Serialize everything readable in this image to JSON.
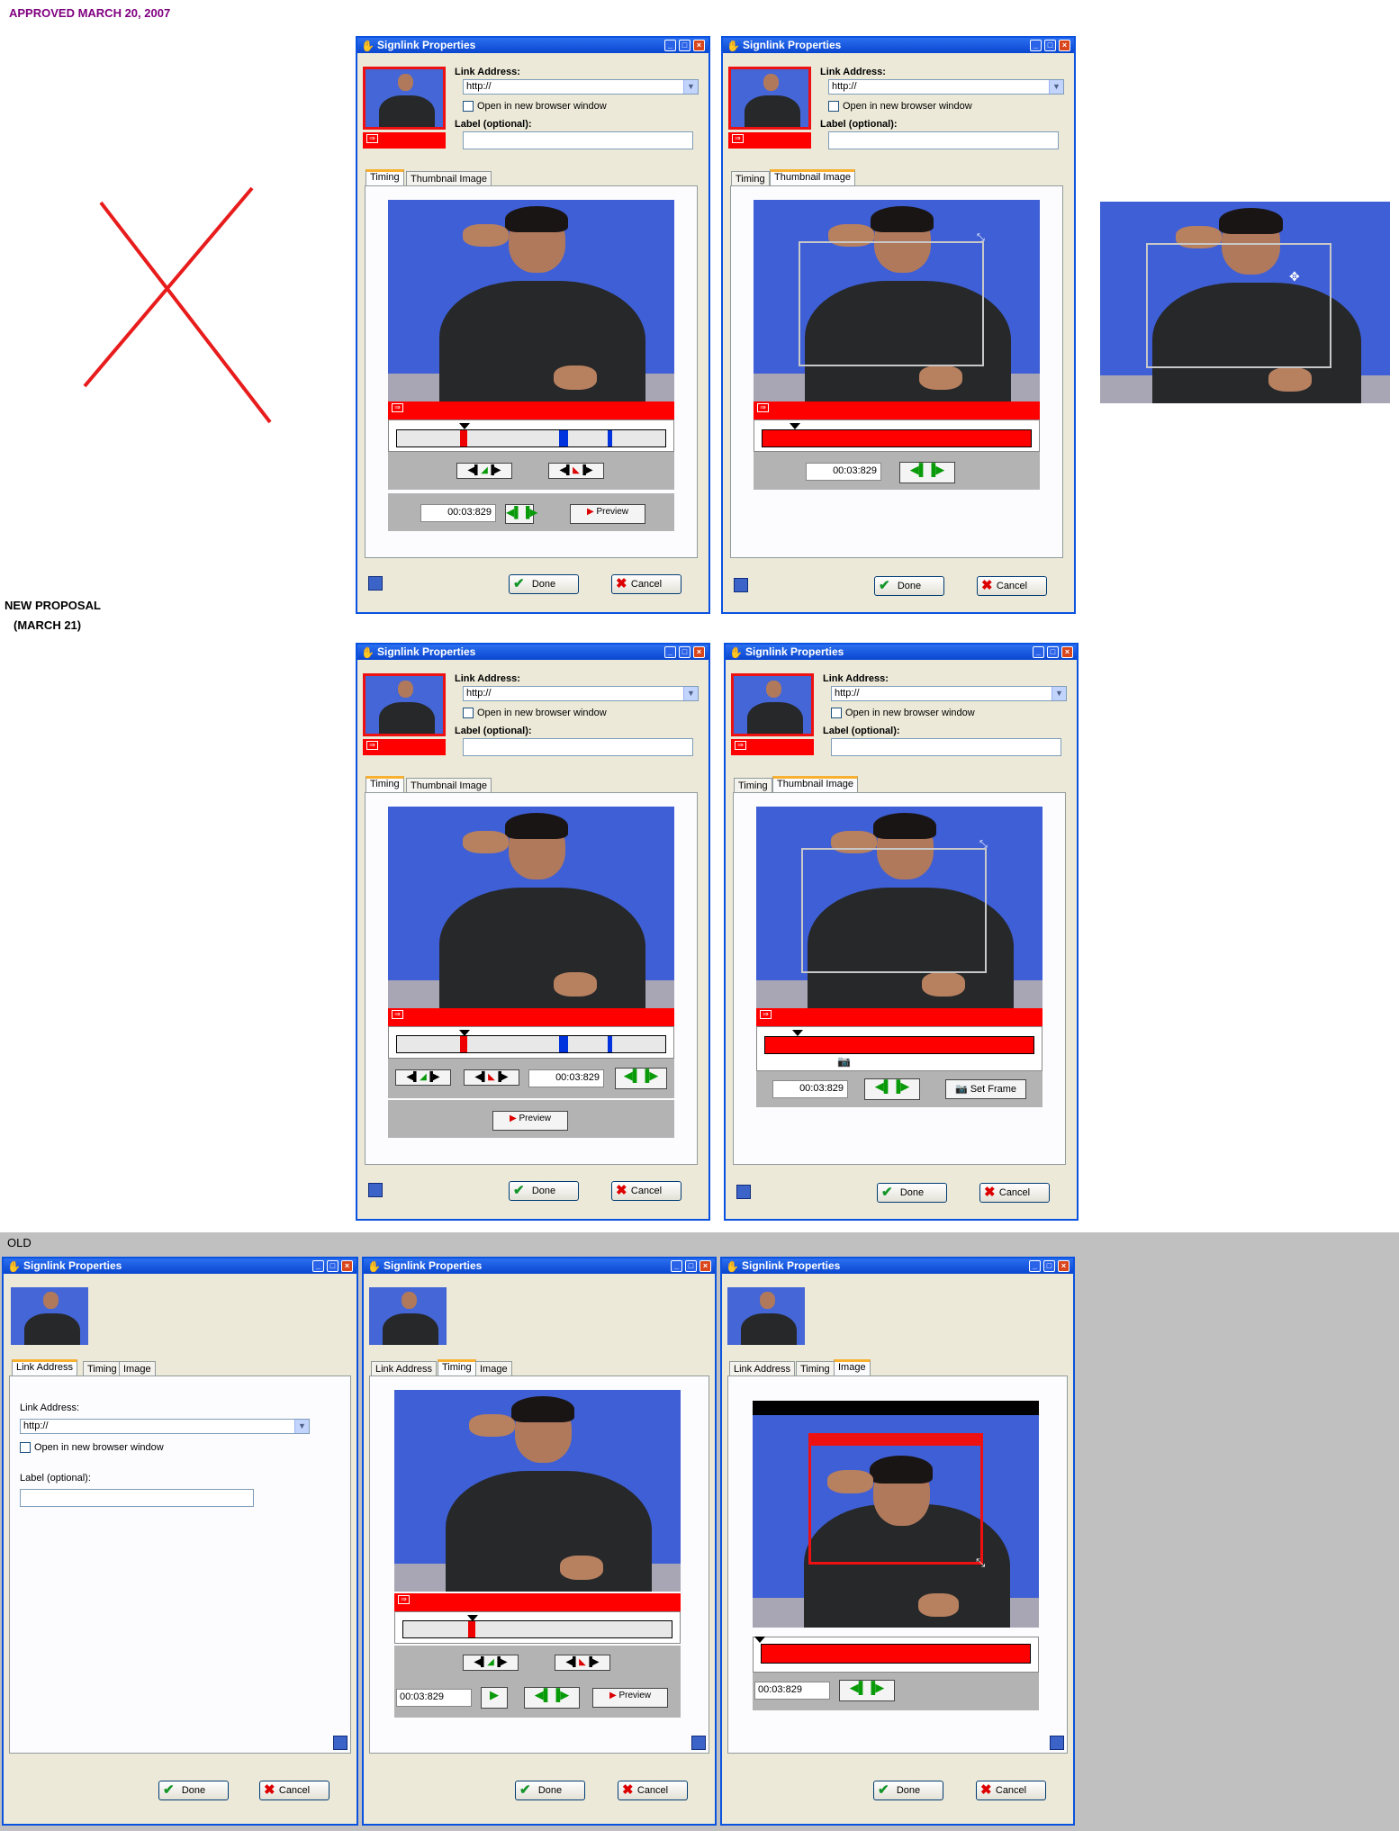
{
  "captions": {
    "approved": "APPROVED MARCH 20, 2007",
    "new_proposal": "NEW PROPOSAL",
    "new_proposal_date": "(MARCH 21)",
    "old": "OLD"
  },
  "dialog": {
    "title": "Signlink Properties",
    "link_address_label": "Link Address:",
    "link_address_label_old": "Link Address:",
    "url": "http://",
    "open_new_window": "Open in new browser window",
    "label_optional": "Label (optional):",
    "label_optional_old": "Label (optional):",
    "done": "Done",
    "cancel": "Cancel",
    "preview": "Preview",
    "set_frame": "Set Frame",
    "time": "00:03:829"
  },
  "tabs": {
    "timing": "Timing",
    "thumbnail_image": "Thumbnail Image",
    "link_address": "Link Address",
    "image": "Image"
  },
  "colors": {
    "title_bar": "#0a46cf",
    "red_bar": "#ff0000",
    "video_bg": "#3f5fd6",
    "old_bg": "#c0c0c0",
    "x_mark": "#e81c1c",
    "approved_caption": "#800080"
  }
}
